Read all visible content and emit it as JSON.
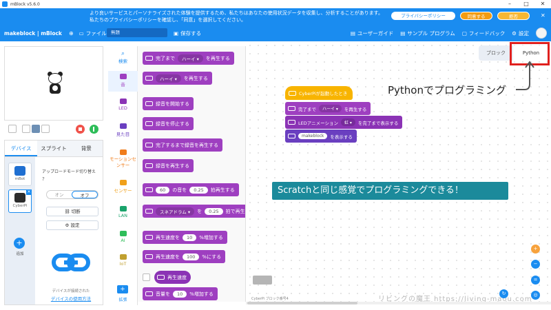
{
  "window": {
    "title": "mBlock v5.6.0"
  },
  "banner": {
    "text": "より良いサービスとパーソナライズされた体験を提供するため、私たちはあなたの使用状況データを収集し、分析することがあります。私たちのプライバシーポリシーを確認し、「同意」を選択してください。",
    "policy_label": "プライバシーポリシー",
    "agree_label": "同意する",
    "decline_label": "拒否"
  },
  "toolbar": {
    "logo": "makeblock | mBlock",
    "file_label": "ファイル",
    "project_name": "無題",
    "save_label": "保存する",
    "guide_label": "ユーザーガイド",
    "sample_label": "サンプル プログラム",
    "feedback_label": "フィードバック",
    "settings_label": "設定"
  },
  "device_panel": {
    "tabs": [
      "デバイス",
      "スプライト",
      "背景"
    ],
    "devices": [
      "mBot",
      "CyberPi"
    ],
    "add_label": "追加",
    "upload_mode_label": "アップロードモード切り替え",
    "toggle_on": "オン",
    "toggle_off": "オフ",
    "disconnect_label": "切断",
    "settings_label": "設定",
    "connected_note": "デバイスが接続された",
    "usage_link": "デバイスの使用方法"
  },
  "categories": [
    {
      "label": "検索",
      "color": "#1a8cf0"
    },
    {
      "label": "音",
      "color": "#9e3fc0"
    },
    {
      "label": "LED",
      "color": "#8b33b5"
    },
    {
      "label": "見た目",
      "color": "#6a3fc0"
    },
    {
      "label": "モーションセンサー",
      "color": "#f07c1a"
    },
    {
      "label": "センサー",
      "color": "#f0a01a"
    },
    {
      "label": "LAN",
      "color": "#1aa36b"
    },
    {
      "label": "AI",
      "color": "#2ebd59"
    },
    {
      "label": "IoT",
      "color": "#c0a030"
    },
    {
      "label": "拡張",
      "color": "#1a8cf0"
    }
  ],
  "palette": {
    "b1_text": "完了まで",
    "b1_sel": "ハーイ ▾",
    "b1_tail": "を再生する",
    "b2_sel": "ハーイ ▾",
    "b2_tail": "を再生する",
    "b3": "録音を開始する",
    "b4": "録音を停止する",
    "b5": "完了するまで録音を再生する",
    "b6": "録音を再生する",
    "b7_val1": "60",
    "b7_mid": "の音を",
    "b7_val2": "0.25",
    "b7_tail": "拍再生する",
    "b8_sel": "スネアドラム ▾",
    "b8_mid": "を",
    "b8_val": "0.25",
    "b8_tail": "拍で再生",
    "b9_head": "再生速度を",
    "b9_val": "10",
    "b9_tail": "%増加する",
    "b10_head": "再生速度を",
    "b10_val": "100",
    "b10_tail": "%にする",
    "b11": "再生速度",
    "b12_head": "音量を",
    "b12_val": "10",
    "b12_tail": "%増加する"
  },
  "script": {
    "view_tabs": [
      "ブロック",
      "Python"
    ],
    "annotation_python": "Pythonでプログラミング",
    "hat_label": "CyberPiが起動したとき",
    "s1_text": "完了まで",
    "s1_sel": "ハーイ ▾",
    "s1_tail": "を再生する",
    "s2_text": "LEDアニメーション",
    "s2_sel": "虹 ▾",
    "s2_tail": "を完了まで表示する",
    "s3_val": "makeblock",
    "s3_tail": "を表示する",
    "caption": "Scratchと同じ感覚でプログラミングできる！",
    "watermark": "リビングの魔王 https://living-maou.com",
    "bottom_label": "CyberPi ブロック番号4"
  }
}
